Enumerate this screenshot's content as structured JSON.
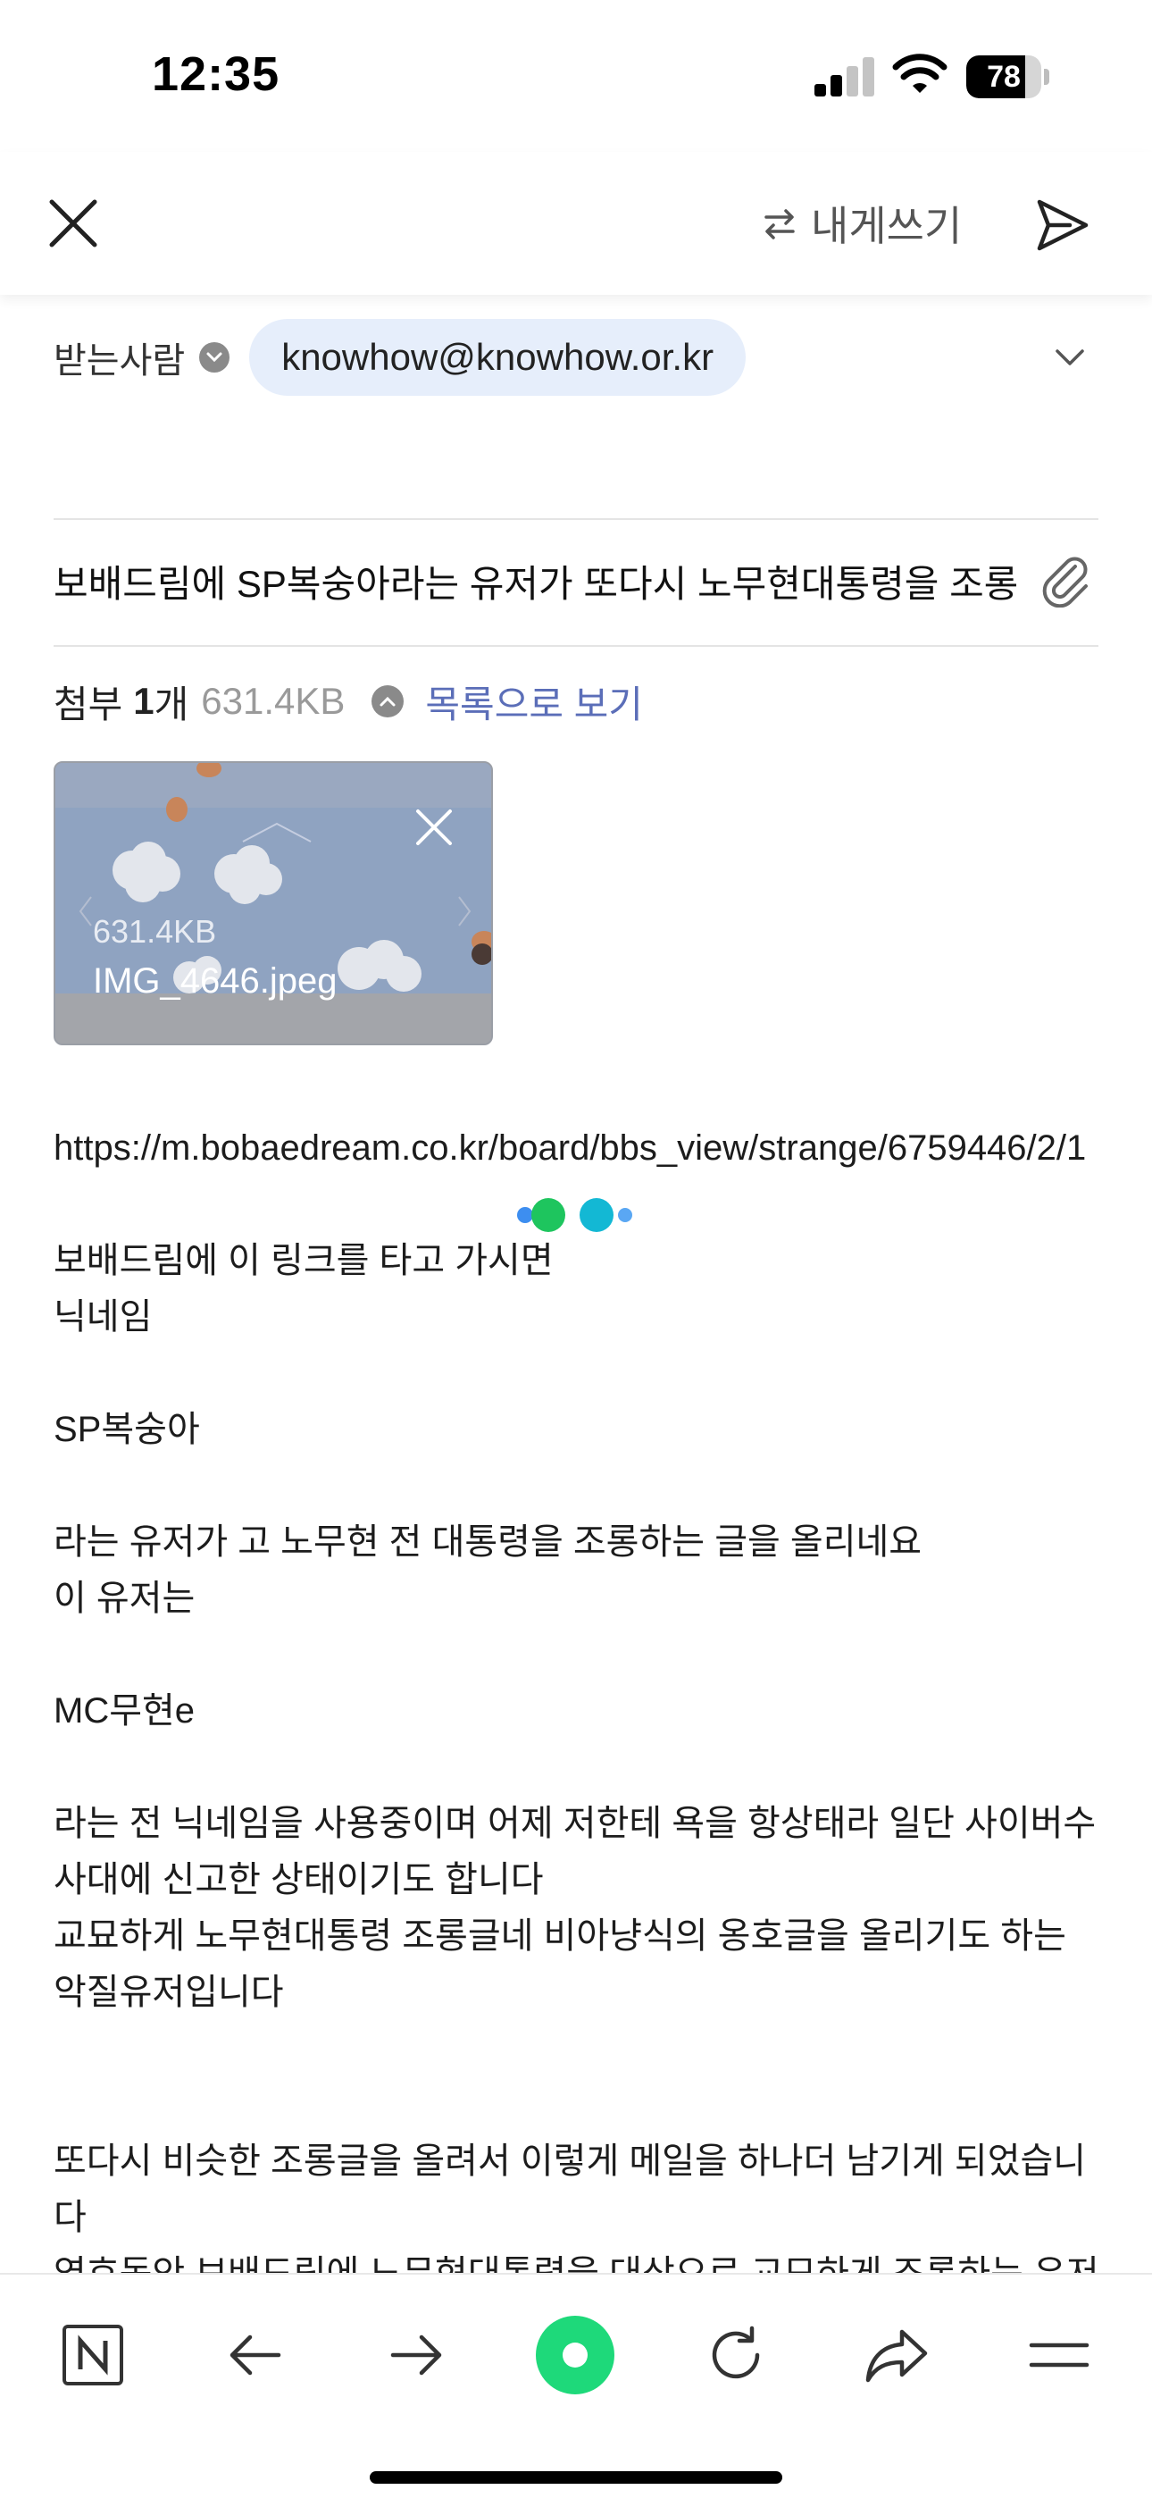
{
  "status_bar": {
    "time": "12:35",
    "battery_level": "78",
    "battery_fraction": 0.78,
    "signal_bars_active": 2,
    "signal_bars_total": 4
  },
  "header": {
    "self_write_label": "내게쓰기",
    "icons": {
      "close": "close-icon",
      "swap": "swap-arrows-icon",
      "send": "send-icon"
    }
  },
  "recipient": {
    "label": "받는사람",
    "address": "knowhow@knowhow.or.kr"
  },
  "subject": {
    "text": "보배드림에 SP복숭아라는 유저가 또다시 노무현대통령을 조롱"
  },
  "attachments": {
    "label": "첨부",
    "count": "1",
    "count_unit": "개",
    "total_size": "631.4KB",
    "list_link": "목록으로 보기",
    "items": [
      {
        "size": "631.4KB",
        "name": "IMG_4646.jpeg"
      }
    ]
  },
  "body": {
    "lines": [
      "https://m.bobaedream.co.kr/board/bbs_view/strange/6759446/2/1",
      "",
      "보배드림에 이 링크를 타고 가시면",
      "닉네임",
      "",
      "SP복숭아",
      "",
      "라는 유저가 고 노무현 전 대통령을 조롱하는 글을 올리네요",
      "이 유저는",
      "",
      "MC무현e",
      "",
      "라는 전 닉네임을 사용중이며 어제 저한테 욕을 항상태라 일단 사이버수사대에 신고한 상태이기도 합니다",
      "교묘하게 노무현대통령 조롱글네 비아냥식의 옹호글을 올리기도 하는 악질유저입니다",
      "",
      "",
      "또다시 비슷한 조롱글을 올려서 이렇게 메일을 하나더 남기게 되었습니다",
      "영호동안 보배드림에 노무현대통령을 대상으로 교묘하게 조롱하는 유저들"
    ]
  },
  "toolbar": {
    "items": [
      "naver-n-icon",
      "back-arrow-icon",
      "forward-arrow-icon",
      "green-dot-icon",
      "refresh-icon",
      "share-icon",
      "menu-icon"
    ]
  },
  "colors": {
    "chip_bg": "#e6eefb",
    "link": "#5b6eb8",
    "green_button": "#1ed97a"
  }
}
